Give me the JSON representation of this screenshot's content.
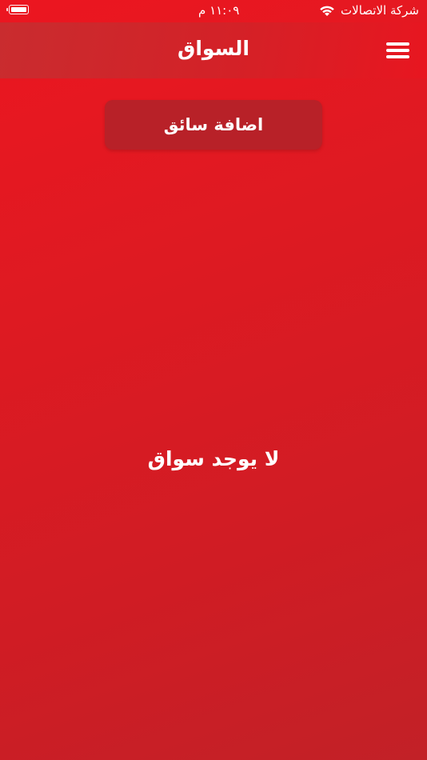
{
  "status_bar": {
    "carrier": "شركة الاتصالات",
    "time": "١١:٠٩ م",
    "wifi_icon": "wifi-icon",
    "battery_icon": "battery-icon"
  },
  "nav": {
    "title": "السواق",
    "menu_icon": "hamburger-menu-icon"
  },
  "actions": {
    "add_driver_label": "اضافة سائق"
  },
  "content": {
    "empty_message": "لا يوجد سواق"
  },
  "colors": {
    "background": "#d91c24",
    "nav_bar": "#d42127",
    "button": "#b82128",
    "text": "#ffffff"
  }
}
